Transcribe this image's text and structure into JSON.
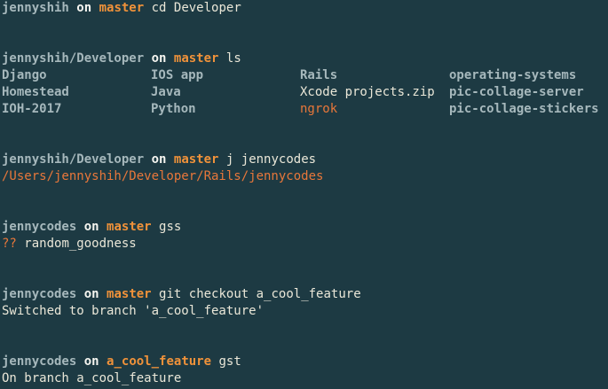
{
  "colors": {
    "background": "#1d3a43",
    "path": "#a6b8bc",
    "branch": "#f0923a",
    "text": "#eae7d8",
    "highlight": "#e8773a"
  },
  "blocks": [
    {
      "path": "jennyshih",
      "on": "on",
      "branch": "master",
      "command": "cd Developer"
    },
    {
      "path": "jennyshih/Developer",
      "on": "on",
      "branch": "master",
      "command": "ls"
    },
    {
      "path": "jennyshih/Developer",
      "on": "on",
      "branch": "master",
      "command": "j jennycodes"
    },
    {
      "path": "jennycodes",
      "on": "on",
      "branch": "master",
      "command": "gss"
    },
    {
      "path": "jennycodes",
      "on": "on",
      "branch": "master",
      "command": "git checkout a_cool_feature"
    },
    {
      "path": "jennycodes",
      "on": "on",
      "branch": "a_cool_feature",
      "command": "gst"
    }
  ],
  "ls_listing": [
    [
      "Django",
      "IOS app",
      "Rails",
      "operating-systems"
    ],
    [
      "Homestead",
      "Java",
      "Xcode projects.zip",
      "pic-collage-server"
    ],
    [
      "IOH-2017",
      "Python",
      "ngrok",
      "pic-collage-stickers"
    ]
  ],
  "outputs": {
    "j_result": "/Users/jennyshih/Developer/Rails/jennycodes",
    "gss_marker": "??",
    "gss_file": "random_goodness",
    "checkout_result": "Switched to branch 'a_cool_feature'",
    "gst_result": "On branch a_cool_feature"
  }
}
